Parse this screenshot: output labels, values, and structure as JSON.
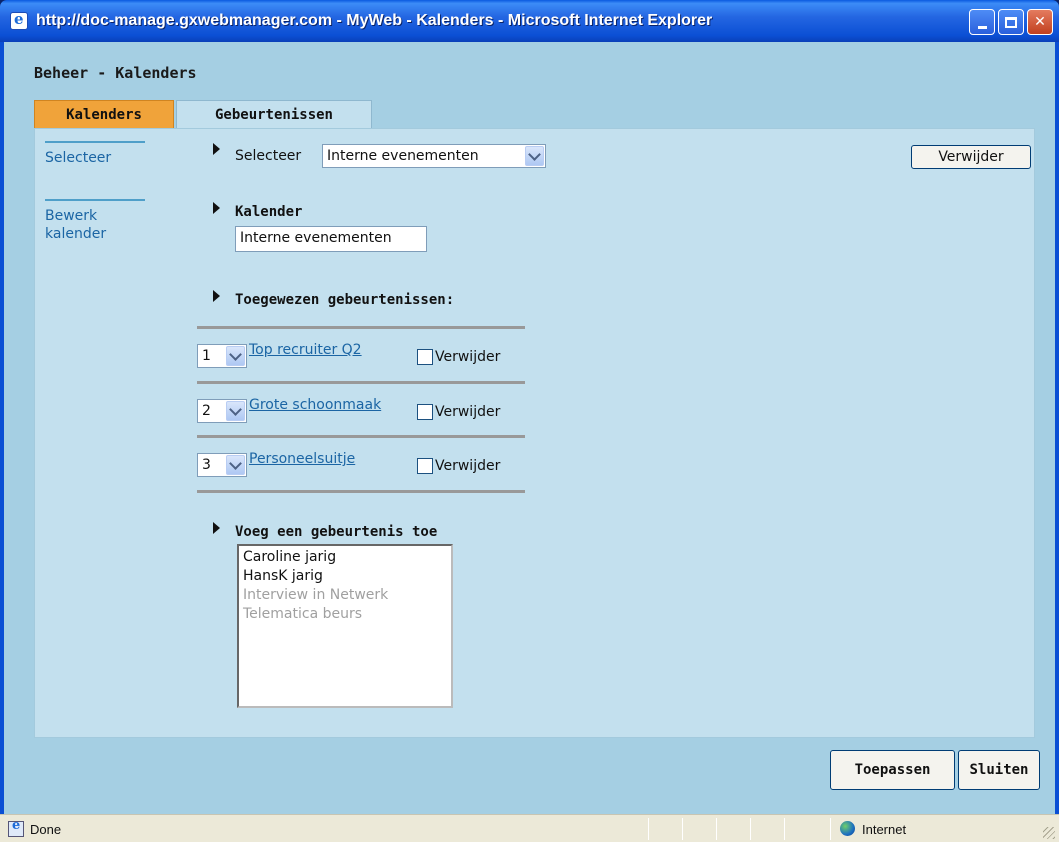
{
  "window": {
    "title": "http://doc-manage.gxwebmanager.com - MyWeb - Kalenders - Microsoft Internet Explorer"
  },
  "page": {
    "heading": "Beheer - Kalenders",
    "tabs": [
      {
        "label": "Kalenders",
        "active": true
      },
      {
        "label": "Gebeurtenissen",
        "active": false
      }
    ]
  },
  "sidebar": {
    "items": [
      {
        "label": "Selecteer"
      },
      {
        "label": "Bewerk kalender"
      }
    ]
  },
  "selector": {
    "label": "Selecteer",
    "selected": "Interne evenementen",
    "delete_button": "Verwijder"
  },
  "calendar": {
    "heading": "Kalender",
    "name_value": "Interne evenementen"
  },
  "assigned": {
    "heading": "Toegewezen gebeurtenissen:",
    "events": [
      {
        "order": "1",
        "name": "Top recruiter Q2",
        "delete_label": "Verwijder"
      },
      {
        "order": "2",
        "name": "Grote schoonmaak",
        "delete_label": "Verwijder"
      },
      {
        "order": "3",
        "name": "Personeelsuitje",
        "delete_label": "Verwijder"
      }
    ]
  },
  "add_event": {
    "heading": "Voeg een gebeurtenis toe",
    "options": [
      {
        "label": "Caroline jarig",
        "enabled": true
      },
      {
        "label": "HansK jarig",
        "enabled": true
      },
      {
        "label": "Interview in Netwerk",
        "enabled": false
      },
      {
        "label": "Telematica beurs",
        "enabled": false
      }
    ]
  },
  "footer": {
    "apply_button": "Toepassen",
    "close_button": "Sluiten"
  },
  "statusbar": {
    "status": "Done",
    "zone": "Internet"
  },
  "icons": {
    "app": "ie-icon",
    "zone": "globe-icon"
  }
}
